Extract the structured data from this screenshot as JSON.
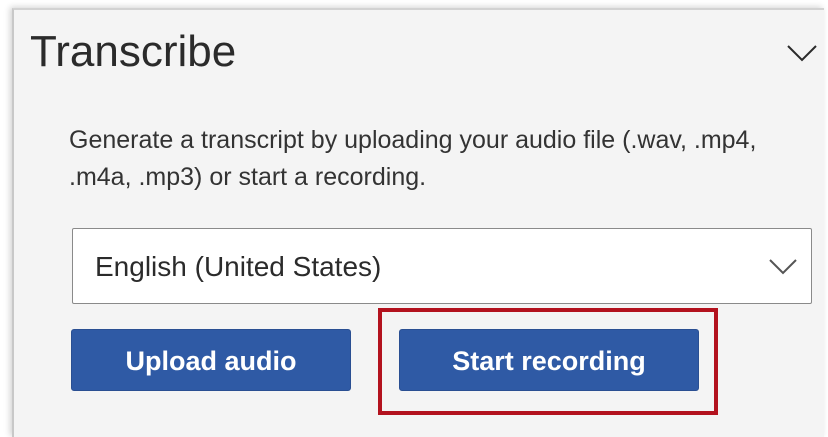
{
  "panel": {
    "title": "Transcribe",
    "description": "Generate a transcript by uploading your audio file (.wav, .mp4, .m4a, .mp3) or start a recording.",
    "collapse_icon": "chevron-down-icon"
  },
  "language_select": {
    "selected": "English (United States)",
    "icon": "chevron-down-icon"
  },
  "buttons": {
    "upload_label": "Upload audio",
    "record_label": "Start recording"
  },
  "colors": {
    "button_bg": "#2f5aa5",
    "highlight_border": "#b3121e",
    "panel_bg": "#f4f4f4"
  }
}
